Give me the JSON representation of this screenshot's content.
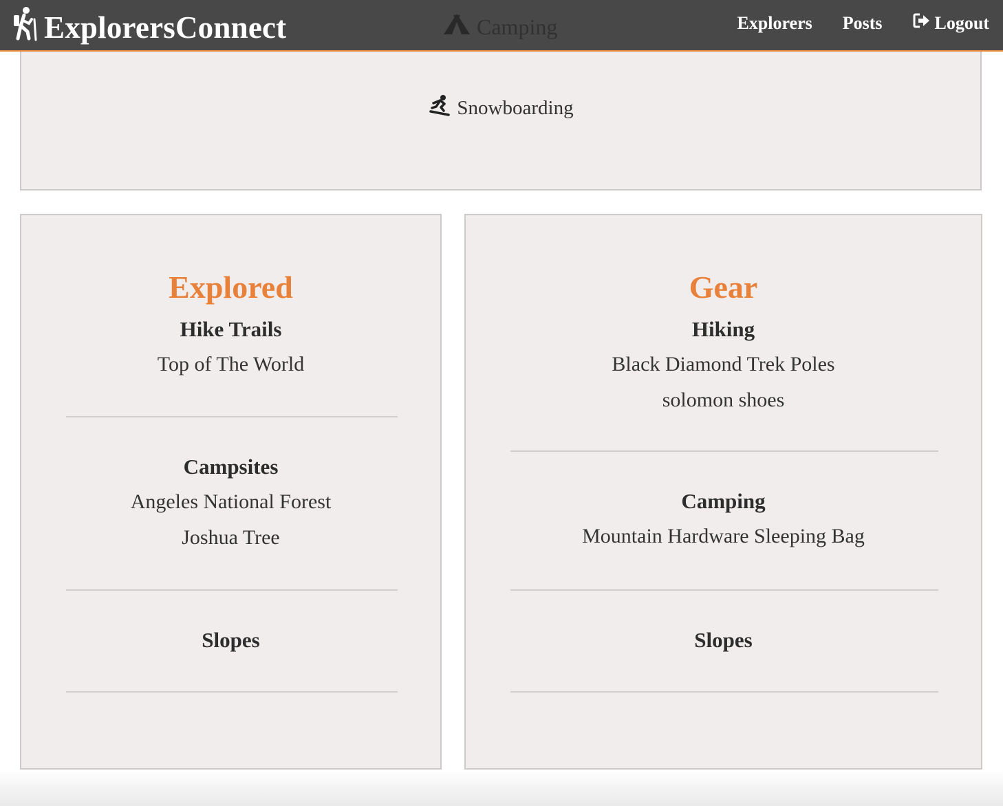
{
  "nav": {
    "brand": "ExplorersConnect",
    "links": [
      {
        "label": "Explorers"
      },
      {
        "label": "Posts"
      },
      {
        "label": "Logout"
      }
    ]
  },
  "activities": {
    "camping": "Camping",
    "snowboarding": "Snowboarding"
  },
  "explored": {
    "title": "Explored",
    "sections": [
      {
        "heading": "Hike Trails",
        "items": [
          "Top of  The World"
        ]
      },
      {
        "heading": "Campsites",
        "items": [
          "Angeles National Forest",
          "Joshua Tree"
        ]
      },
      {
        "heading": "Slopes",
        "items": []
      }
    ]
  },
  "gear": {
    "title": "Gear",
    "sections": [
      {
        "heading": "Hiking",
        "items": [
          "Black Diamond Trek Poles",
          "solomon shoes"
        ]
      },
      {
        "heading": "Camping",
        "items": [
          "Mountain Hardware Sleeping Bag"
        ]
      },
      {
        "heading": "Slopes",
        "items": []
      }
    ]
  },
  "colors": {
    "accent": "#e8813a",
    "navbar": "#484848",
    "card": "#f2eded"
  }
}
